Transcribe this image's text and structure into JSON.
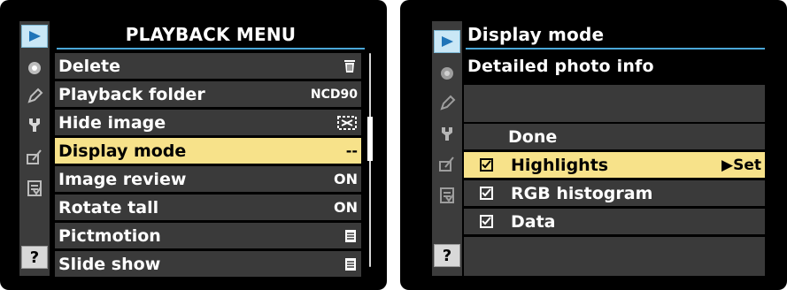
{
  "playback_menu": {
    "title": "PLAYBACK MENU",
    "items": [
      {
        "label": "Delete",
        "value": "",
        "icon": "trash-icon"
      },
      {
        "label": "Playback folder",
        "value": "NCD90"
      },
      {
        "label": "Hide image",
        "value": "",
        "icon": "hide-image-icon"
      },
      {
        "label": "Display mode",
        "value": "--",
        "selected": true
      },
      {
        "label": "Image review",
        "value": "ON"
      },
      {
        "label": "Rotate tall",
        "value": "ON"
      },
      {
        "label": "Pictmotion",
        "value": "",
        "icon": "pictmotion-icon"
      },
      {
        "label": "Slide show",
        "value": "",
        "icon": "slideshow-icon"
      }
    ]
  },
  "display_mode": {
    "title": "Display mode",
    "subtitle": "Detailed photo info",
    "items": [
      {
        "label": "Done",
        "checked": false
      },
      {
        "label": "Highlights",
        "checked": true,
        "selected": true,
        "action": "▶Set"
      },
      {
        "label": "RGB histogram",
        "checked": true
      },
      {
        "label": "Data",
        "checked": true
      }
    ]
  },
  "sidebar": {
    "tabs": [
      "playback-tab",
      "shooting-tab",
      "custom-settings-tab",
      "setup-tab",
      "retouch-tab",
      "my-menu-tab",
      "help-tab"
    ],
    "help_label": "?"
  },
  "colors": {
    "selected_row": "#f7e28a",
    "row": "#3a3a3a",
    "sidebar": "#3c3c3c",
    "title_rule": "#4aa7d8",
    "active_tab": "#c9e7f6"
  }
}
